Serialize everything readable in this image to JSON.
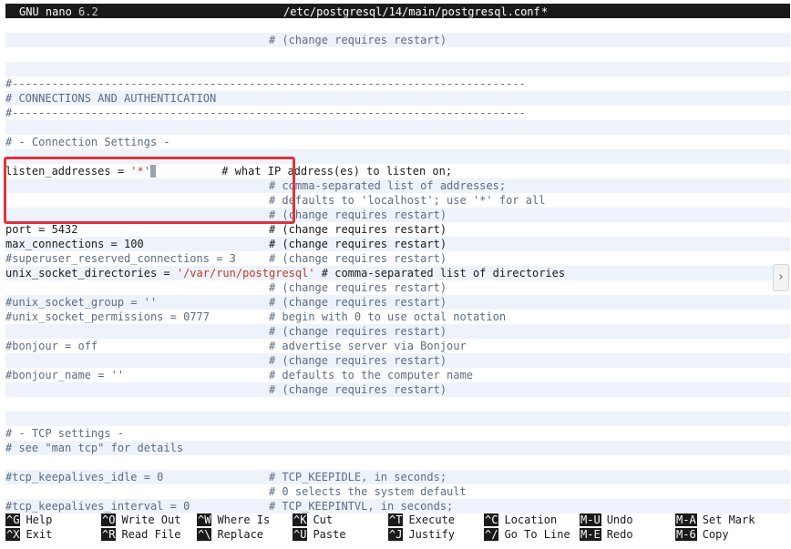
{
  "titlebar": {
    "app": "GNU nano",
    "version": "6.2",
    "file": "/etc/postgresql/14/main/postgresql.conf",
    "modified": "*"
  },
  "buffer": [
    {
      "parts": [
        {
          "t": "",
          "c": "k"
        }
      ]
    },
    {
      "parts": [
        {
          "t": "                                        # (change requires restart)",
          "c": "c"
        }
      ]
    },
    {
      "parts": [
        {
          "t": "",
          "c": "k"
        }
      ]
    },
    {
      "parts": [
        {
          "t": "",
          "c": "k"
        }
      ]
    },
    {
      "parts": [
        {
          "t": "#------------------------------------------------------------------------------",
          "c": "c"
        }
      ]
    },
    {
      "parts": [
        {
          "t": "# CONNECTIONS AND AUTHENTICATION",
          "c": "c"
        }
      ]
    },
    {
      "parts": [
        {
          "t": "#------------------------------------------------------------------------------",
          "c": "c"
        }
      ]
    },
    {
      "parts": [
        {
          "t": "",
          "c": "k"
        }
      ]
    },
    {
      "parts": [
        {
          "t": "# - Connection Settings -",
          "c": "c"
        }
      ]
    },
    {
      "parts": [
        {
          "t": "",
          "c": "k"
        }
      ]
    },
    {
      "parts": [
        {
          "t": "listen_addresses = ",
          "c": "k"
        },
        {
          "t": "'*'",
          "c": "s"
        },
        {
          "t": "CURSOR",
          "c": "cursor"
        },
        {
          "t": "          # what IP address(es) to listen on;",
          "c": "k"
        }
      ]
    },
    {
      "parts": [
        {
          "t": "                                        # comma-separated list of addresses;",
          "c": "c"
        }
      ]
    },
    {
      "parts": [
        {
          "t": "                                        # defaults to 'localhost'; use '*' for all",
          "c": "c"
        }
      ]
    },
    {
      "parts": [
        {
          "t": "                                        # (change requires restart)",
          "c": "c"
        }
      ]
    },
    {
      "parts": [
        {
          "t": "port = 5432                             # (change requires restart)",
          "c": "k"
        }
      ]
    },
    {
      "parts": [
        {
          "t": "max_connections = 100                   # (change requires restart)",
          "c": "k"
        }
      ]
    },
    {
      "parts": [
        {
          "t": "#superuser_reserved_connections = 3     # (change requires restart)",
          "c": "c"
        }
      ]
    },
    {
      "parts": [
        {
          "t": "unix_socket_directories = ",
          "c": "k"
        },
        {
          "t": "'/var/run/postgresql'",
          "c": "s"
        },
        {
          "t": " # comma-separated list of directories",
          "c": "k"
        }
      ]
    },
    {
      "parts": [
        {
          "t": "                                        # (change requires restart)",
          "c": "c"
        }
      ]
    },
    {
      "parts": [
        {
          "t": "#unix_socket_group = ''                 # (change requires restart)",
          "c": "c"
        }
      ]
    },
    {
      "parts": [
        {
          "t": "#unix_socket_permissions = 0777         # begin with 0 to use octal notation",
          "c": "c"
        }
      ]
    },
    {
      "parts": [
        {
          "t": "                                        # (change requires restart)",
          "c": "c"
        }
      ]
    },
    {
      "parts": [
        {
          "t": "#bonjour = off                          # advertise server via Bonjour",
          "c": "c"
        }
      ]
    },
    {
      "parts": [
        {
          "t": "                                        # (change requires restart)",
          "c": "c"
        }
      ]
    },
    {
      "parts": [
        {
          "t": "#bonjour_name = ''                      # defaults to the computer name",
          "c": "c"
        }
      ]
    },
    {
      "parts": [
        {
          "t": "                                        # (change requires restart)",
          "c": "c"
        }
      ]
    },
    {
      "parts": [
        {
          "t": "",
          "c": "k"
        }
      ]
    },
    {
      "parts": [
        {
          "t": "",
          "c": "k"
        }
      ]
    },
    {
      "parts": [
        {
          "t": "# - TCP settings -",
          "c": "c"
        }
      ]
    },
    {
      "parts": [
        {
          "t": "# see \"man tcp\" for details",
          "c": "c"
        }
      ]
    },
    {
      "parts": [
        {
          "t": "",
          "c": "k"
        }
      ]
    },
    {
      "parts": [
        {
          "t": "#tcp_keepalives_idle = 0                # TCP_KEEPIDLE, in seconds;",
          "c": "c"
        }
      ]
    },
    {
      "parts": [
        {
          "t": "                                        # 0 selects the system default",
          "c": "c"
        }
      ]
    },
    {
      "parts": [
        {
          "t": "#tcp_keepalives_interval = 0            # TCP_KEEPINTVL, in seconds;",
          "c": "c"
        }
      ]
    }
  ],
  "shortcuts": [
    {
      "key": "^G",
      "label": "Help"
    },
    {
      "key": "^X",
      "label": "Exit"
    },
    {
      "key": "^O",
      "label": "Write Out"
    },
    {
      "key": "^R",
      "label": "Read File"
    },
    {
      "key": "^W",
      "label": "Where Is"
    },
    {
      "key": "^\\",
      "label": "Replace"
    },
    {
      "key": "^K",
      "label": "Cut"
    },
    {
      "key": "^U",
      "label": "Paste"
    },
    {
      "key": "^T",
      "label": "Execute"
    },
    {
      "key": "^J",
      "label": "Justify"
    },
    {
      "key": "^C",
      "label": "Location"
    },
    {
      "key": "^/",
      "label": "Go To Line"
    },
    {
      "key": "M-U",
      "label": "Undo"
    },
    {
      "key": "M-E",
      "label": "Redo"
    },
    {
      "key": "M-A",
      "label": "Set Mark"
    },
    {
      "key": "M-6",
      "label": "Copy"
    }
  ],
  "scroll_icon": "chevron-right-icon",
  "colors": {
    "highlight_box": "#e0323c",
    "string": "#c0392b",
    "comment": "#5c6c82"
  }
}
